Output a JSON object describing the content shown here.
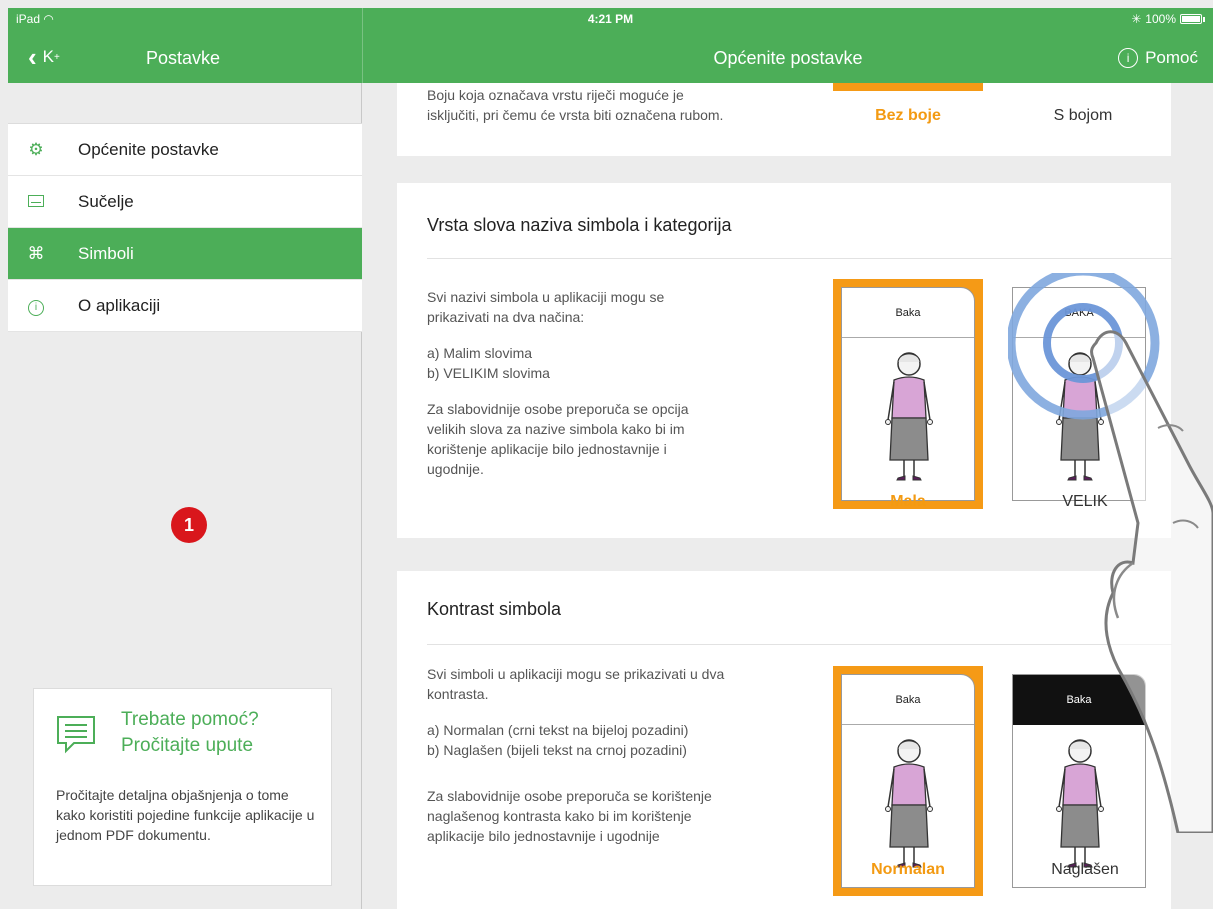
{
  "status": {
    "left": "iPad",
    "time": "4:21 PM",
    "battery": "100%"
  },
  "nav": {
    "back_label": "K",
    "back_sup": "+",
    "sidebar_title": "Postavke",
    "main_title": "Općenite postavke",
    "help_label": "Pomoć"
  },
  "sidebar": {
    "items": [
      {
        "label": "Općenite postavke",
        "icon": "gear-icon",
        "active": false
      },
      {
        "label": "Sučelje",
        "icon": "screen-icon",
        "active": false
      },
      {
        "label": "Simboli",
        "icon": "symbol-icon",
        "active": true
      },
      {
        "label": "O aplikaciji",
        "icon": "info-icon",
        "active": false
      }
    ],
    "badge": "1",
    "help_card": {
      "title_line1": "Trebate pomoć?",
      "title_line2": "Pročitajte upute",
      "text": "Pročitajte detaljna objašnjenja o tome kako koristiti pojedine funkcije aplikacije u jednom PDF dokumentu."
    }
  },
  "sections": {
    "color": {
      "desc_line1": "Boju koja označava vrstu riječi moguće je",
      "desc_line2": "isključiti, pri čemu će vrsta biti označena rubom.",
      "option_selected": "Bez boje",
      "option_other": "S bojom"
    },
    "font": {
      "title": "Vrsta slova naziva simbola i kategorija",
      "desc_line1": "Svi nazivi simbola u aplikaciji mogu se",
      "desc_line2": "prikazivati na dva načina:",
      "desc_line3": "a) Malim slovima",
      "desc_line4": "b) VELIKIM slovima",
      "desc_line5": "Za slabovidnije osobe preporuča se opcija",
      "desc_line6": "velikih slova za nazive simbola kako bi im",
      "desc_line7": "korištenje aplikacije bilo jednostavnije i",
      "desc_line8": "ugodnije.",
      "symbol_small": "Baka",
      "symbol_caps": "BAKA",
      "option_selected": "Mala",
      "option_other": "VELIK"
    },
    "contrast": {
      "title": "Kontrast simbola",
      "desc_line1": "Svi simboli u aplikaciji mogu se prikazivati u dva",
      "desc_line2": "kontrasta.",
      "desc_line3": "a) Normalan (crni tekst na bijeloj pozadini)",
      "desc_line4": "b) Naglašen (bijeli tekst na crnoj pozadini)",
      "desc_line5": "Za slabovidnije osobe preporuča se korištenje",
      "desc_line6": "naglašenog kontrasta kako bi im korištenje",
      "desc_line7": "aplikacije bilo jednostavnije i ugodnije",
      "symbol_normal": "Baka",
      "symbol_bold": "Baka",
      "option_selected": "Normalan",
      "option_other": "Naglašen"
    }
  },
  "colors": {
    "brand_green": "#4cae58",
    "selected_orange": "#f59a16",
    "badge_red": "#d9161c"
  }
}
